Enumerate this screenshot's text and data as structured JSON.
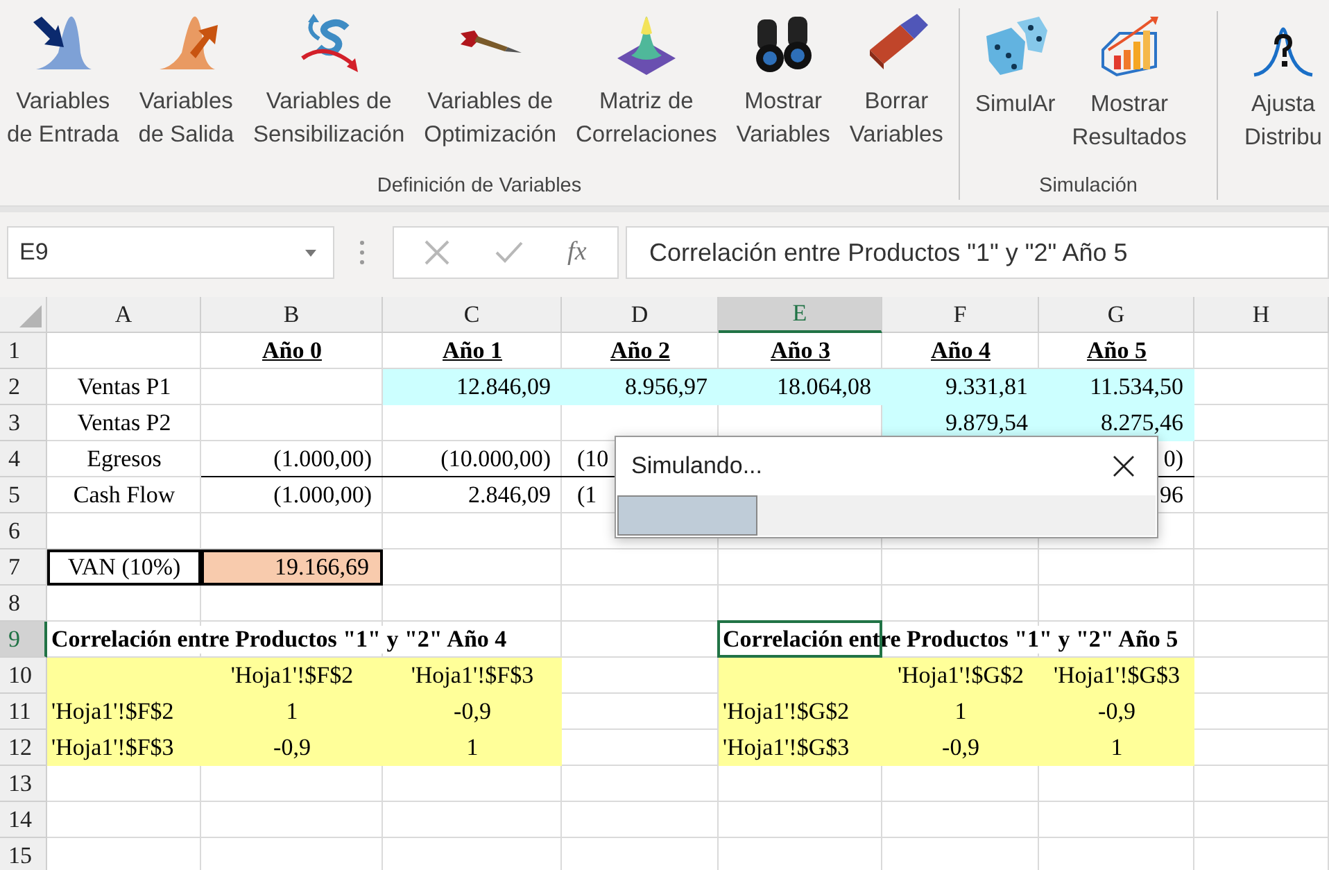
{
  "ribbon": {
    "groups": [
      {
        "label": "Definición de Variables",
        "buttons": [
          {
            "kind": "input",
            "lines": [
              "Variables",
              "de Entrada"
            ]
          },
          {
            "kind": "output",
            "lines": [
              "Variables",
              "de Salida"
            ]
          },
          {
            "kind": "sensitivity",
            "lines": [
              "Variables de",
              "Sensibilización"
            ]
          },
          {
            "kind": "optimization",
            "lines": [
              "Variables de",
              "Optimización"
            ]
          },
          {
            "kind": "correlation",
            "lines": [
              "Matriz de",
              "Correlaciones"
            ]
          },
          {
            "kind": "show",
            "lines": [
              "Mostrar",
              "Variables"
            ]
          },
          {
            "kind": "erase",
            "lines": [
              "Borrar",
              "Variables"
            ]
          }
        ]
      },
      {
        "label": "Simulación",
        "buttons": [
          {
            "kind": "simulate",
            "lines": [
              "SimulAr"
            ]
          },
          {
            "kind": "results",
            "lines": [
              "Mostrar",
              "Resultados"
            ]
          }
        ]
      },
      {
        "buttons": [
          {
            "kind": "fit",
            "lines": [
              "Ajusta",
              "Distribu"
            ]
          }
        ]
      }
    ]
  },
  "formula_bar": {
    "name_box": "E9",
    "function_label": "fx",
    "formula": "Correlación entre Productos \"1\" y \"2\" Año 5"
  },
  "sheet": {
    "columns": [
      {
        "label": "A",
        "selected": false
      },
      {
        "label": "B",
        "selected": false
      },
      {
        "label": "C",
        "selected": false
      },
      {
        "label": "D",
        "selected": false
      },
      {
        "label": "E",
        "selected": true
      },
      {
        "label": "F",
        "selected": false
      },
      {
        "label": "G",
        "selected": false
      },
      {
        "label": "H",
        "selected": false
      }
    ],
    "rows": [
      {
        "number": "1",
        "selected": false,
        "ruled": false,
        "cells": [
          {
            "kind": "blank"
          },
          {
            "kind": "heading",
            "text": "Año 0"
          },
          {
            "kind": "heading",
            "text": "Año 1"
          },
          {
            "kind": "heading",
            "text": "Año 2"
          },
          {
            "kind": "heading",
            "text": "Año 3"
          },
          {
            "kind": "heading",
            "text": "Año 4"
          },
          {
            "kind": "heading",
            "text": "Año 5"
          },
          {
            "kind": "blank"
          }
        ]
      },
      {
        "number": "2",
        "selected": false,
        "ruled": false,
        "cells": [
          {
            "kind": "label",
            "text": "Ventas P1"
          },
          {
            "kind": "blank"
          },
          {
            "kind": "entry",
            "text": "12.846,09"
          },
          {
            "kind": "entry",
            "text": "8.956,97"
          },
          {
            "kind": "entry",
            "text": "18.064,08"
          },
          {
            "kind": "entry",
            "text": "9.331,81"
          },
          {
            "kind": "entry",
            "text": "11.534,50"
          },
          {
            "kind": "blank"
          }
        ]
      },
      {
        "number": "3",
        "selected": false,
        "ruled": false,
        "cells": [
          {
            "kind": "label",
            "text": "Ventas P2"
          },
          {
            "kind": "blank"
          },
          {
            "kind": "blank"
          },
          {
            "kind": "blank"
          },
          {
            "kind": "blank"
          },
          {
            "kind": "entry",
            "text": "9.879,54"
          },
          {
            "kind": "entry",
            "text": "8.275,46"
          },
          {
            "kind": "blank"
          }
        ]
      },
      {
        "number": "4",
        "selected": false,
        "ruled": true,
        "cells": [
          {
            "kind": "label",
            "text": "Egresos"
          },
          {
            "kind": "number",
            "text": "(1.000,00)"
          },
          {
            "kind": "number",
            "text": "(10.000,00)"
          },
          {
            "kind": "fragment",
            "text": "(10"
          },
          {
            "kind": "blank"
          },
          {
            "kind": "blank"
          },
          {
            "kind": "number",
            "text": "0)"
          },
          {
            "kind": "blank"
          }
        ]
      },
      {
        "number": "5",
        "selected": false,
        "ruled": false,
        "cells": [
          {
            "kind": "label",
            "text": "Cash Flow"
          },
          {
            "kind": "number",
            "text": "(1.000,00)"
          },
          {
            "kind": "number",
            "text": "2.846,09"
          },
          {
            "kind": "fragment",
            "text": "(1"
          },
          {
            "kind": "blank"
          },
          {
            "kind": "blank"
          },
          {
            "kind": "number",
            "text": "96"
          },
          {
            "kind": "blank"
          }
        ]
      },
      {
        "number": "6",
        "selected": false,
        "ruled": false,
        "cells": [
          {
            "kind": "blank"
          },
          {
            "kind": "blank"
          },
          {
            "kind": "blank"
          },
          {
            "kind": "blank"
          },
          {
            "kind": "blank"
          },
          {
            "kind": "blank"
          },
          {
            "kind": "blank"
          },
          {
            "kind": "blank"
          }
        ]
      },
      {
        "number": "7",
        "selected": false,
        "ruled": false,
        "cells": [
          {
            "kind": "caption",
            "text": "VAN (10%)"
          },
          {
            "kind": "result",
            "text": "19.166,69"
          },
          {
            "kind": "blank"
          },
          {
            "kind": "blank"
          },
          {
            "kind": "blank"
          },
          {
            "kind": "blank"
          },
          {
            "kind": "blank"
          },
          {
            "kind": "blank"
          }
        ]
      },
      {
        "number": "8",
        "selected": false,
        "ruled": false,
        "cells": [
          {
            "kind": "blank"
          },
          {
            "kind": "blank"
          },
          {
            "kind": "blank"
          },
          {
            "kind": "blank"
          },
          {
            "kind": "blank"
          },
          {
            "kind": "blank"
          },
          {
            "kind": "blank"
          },
          {
            "kind": "blank"
          }
        ]
      },
      {
        "number": "9",
        "selected": true,
        "ruled": false,
        "cells": [
          {
            "kind": "title",
            "text": "Correlación entre Productos \"1\" y \"2\" Año 4"
          },
          {
            "kind": "blank"
          },
          {
            "kind": "blank"
          },
          {
            "kind": "blank"
          },
          {
            "kind": "title",
            "text": "Correlación entre Productos \"1\" y \"2\" Año 5"
          },
          {
            "kind": "blank"
          },
          {
            "kind": "blank"
          },
          {
            "kind": "blank"
          }
        ]
      },
      {
        "number": "10",
        "selected": false,
        "ruled": false,
        "cells": [
          {
            "kind": "matrix"
          },
          {
            "kind": "reference",
            "text": "'Hoja1'!$F$2"
          },
          {
            "kind": "reference",
            "text": "'Hoja1'!$F$3"
          },
          {
            "kind": "blank"
          },
          {
            "kind": "matrix"
          },
          {
            "kind": "reference",
            "text": "'Hoja1'!$G$2"
          },
          {
            "kind": "reference",
            "text": "'Hoja1'!$G$3"
          },
          {
            "kind": "blank"
          }
        ]
      },
      {
        "number": "11",
        "selected": false,
        "ruled": false,
        "cells": [
          {
            "kind": "rowname",
            "text": "'Hoja1'!$F$2"
          },
          {
            "kind": "coefficient",
            "text": "1"
          },
          {
            "kind": "coefficient",
            "text": "-0,9"
          },
          {
            "kind": "blank"
          },
          {
            "kind": "rowname",
            "text": "'Hoja1'!$G$2"
          },
          {
            "kind": "coefficient",
            "text": "1"
          },
          {
            "kind": "coefficient",
            "text": "-0,9"
          },
          {
            "kind": "blank"
          }
        ]
      },
      {
        "number": "12",
        "selected": false,
        "ruled": false,
        "cells": [
          {
            "kind": "rowname",
            "text": "'Hoja1'!$F$3"
          },
          {
            "kind": "coefficient",
            "text": "-0,9"
          },
          {
            "kind": "coefficient",
            "text": "1"
          },
          {
            "kind": "blank"
          },
          {
            "kind": "rowname",
            "text": "'Hoja1'!$G$3"
          },
          {
            "kind": "coefficient",
            "text": "-0,9"
          },
          {
            "kind": "coefficient",
            "text": "1"
          },
          {
            "kind": "blank"
          }
        ]
      },
      {
        "number": "13",
        "selected": false,
        "ruled": false,
        "cells": [
          {
            "kind": "blank"
          },
          {
            "kind": "blank"
          },
          {
            "kind": "blank"
          },
          {
            "kind": "blank"
          },
          {
            "kind": "blank"
          },
          {
            "kind": "blank"
          },
          {
            "kind": "blank"
          },
          {
            "kind": "blank"
          }
        ]
      },
      {
        "number": "14",
        "selected": false,
        "ruled": false,
        "cells": [
          {
            "kind": "blank"
          },
          {
            "kind": "blank"
          },
          {
            "kind": "blank"
          },
          {
            "kind": "blank"
          },
          {
            "kind": "blank"
          },
          {
            "kind": "blank"
          },
          {
            "kind": "blank"
          },
          {
            "kind": "blank"
          }
        ]
      },
      {
        "number": "15",
        "selected": false,
        "ruled": false,
        "cells": [
          {
            "kind": "blank"
          },
          {
            "kind": "blank"
          },
          {
            "kind": "blank"
          },
          {
            "kind": "blank"
          },
          {
            "kind": "blank"
          },
          {
            "kind": "blank"
          },
          {
            "kind": "blank"
          },
          {
            "kind": "blank"
          }
        ]
      }
    ]
  },
  "dialog": {
    "title": "Simulando...",
    "level": 0.26
  }
}
